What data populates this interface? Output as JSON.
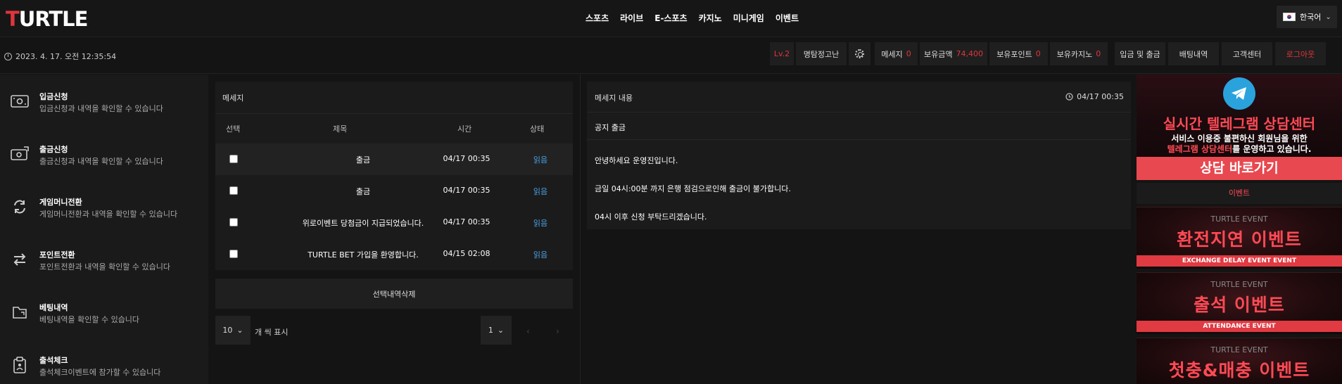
{
  "header": {
    "logo_first": "T",
    "logo_rest": "URTLE",
    "nav": [
      "스포츠",
      "라이브",
      "E-스포츠",
      "카지노",
      "미니게임",
      "이벤트"
    ],
    "language": "한국어"
  },
  "infobar": {
    "datetime": "2023. 4. 17. 오전 12:35:54",
    "level": "Lv.2",
    "nickname": "명탐정고난",
    "message_label": "메세지",
    "message_count": "0",
    "balance_label": "보유금액",
    "balance_value": "74,400",
    "points_label": "보유포인트",
    "points_value": "0",
    "casino_label": "보유카지노",
    "casino_value": "0",
    "deposit_withdraw": "입금 및 출금",
    "bet_history": "배팅내역",
    "support": "고객센터",
    "logout": "로그아웃"
  },
  "sidebar": {
    "items": [
      {
        "title": "입금신청",
        "desc": "입금신청과 내역을 확인할 수 있습니다"
      },
      {
        "title": "출금신청",
        "desc": "출금신청과 내역을 확인할 수 있습니다"
      },
      {
        "title": "게임머니전환",
        "desc": "게임머니전환과 내역을 확인할 수 있습니다"
      },
      {
        "title": "포인트전환",
        "desc": "포인트전환과 내역을 확인할 수 있습니다"
      },
      {
        "title": "베팅내역",
        "desc": "베팅내역을 확인할 수 있습니다"
      },
      {
        "title": "출석체크",
        "desc": "출석체크이벤트에 참가할 수 있습니다"
      }
    ]
  },
  "messages": {
    "title": "메세지",
    "columns": {
      "select": "선택",
      "subject": "제목",
      "time": "시간",
      "status": "상태"
    },
    "rows": [
      {
        "subject": "출금",
        "time": "04/17 00:35",
        "status": "읽음"
      },
      {
        "subject": "출금",
        "time": "04/17 00:35",
        "status": "읽음"
      },
      {
        "subject": "위로이벤트 당첨금이 지급되었습니다.",
        "time": "04/17 00:35",
        "status": "읽음"
      },
      {
        "subject": "TURTLE BET 가입을 환영합니다.",
        "time": "04/15 02:08",
        "status": "읽음"
      }
    ],
    "delete_label": "선택내역삭제",
    "per_page": "10",
    "per_page_label": "개 씩 표시",
    "page": "1"
  },
  "content": {
    "title": "메세지 내용",
    "date": "04/17 00:35",
    "heading": "공지 출금",
    "lines": [
      "안녕하세요 운영진입니다.",
      "금일 04시:00분 까지 은행 점검으로인해 출금이 불가합니다.",
      "04시 이후 신청 부탁드리겠습니다."
    ]
  },
  "banners": {
    "telegram_line1": "실시간 텔레그램 상담센터",
    "telegram_line2": "서비스 이용중 불편하신 회원님을 위한",
    "telegram_line3_red": "텔레그램 상담센터",
    "telegram_line3_rest": "를 운영하고 있습니다.",
    "telegram_button": "상담 바로가기",
    "event_header": "이벤트",
    "events": [
      {
        "top": "TURTLE EVENT",
        "main": "환전지연 이벤트",
        "bottom": "EXCHANGE DELAY EVENT EVENT"
      },
      {
        "top": "TURTLE EVENT",
        "main": "출석 이벤트",
        "bottom": "ATTENDANCE EVENT"
      },
      {
        "top": "TURTLE EVENT",
        "main": "첫충&매충 이벤트",
        "bottom": ""
      }
    ]
  },
  "colors": {
    "accent": "#e0353d",
    "link": "#4a9fe0",
    "telegram": "#2aa3dd"
  }
}
